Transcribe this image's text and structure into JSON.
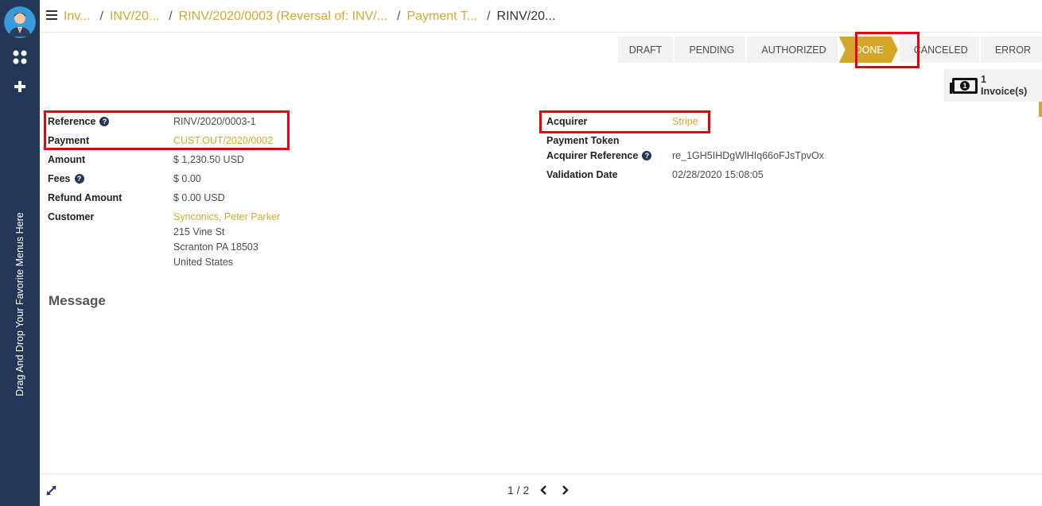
{
  "sidebar": {
    "favorites_hint": "Drag And Drop Your Favorite Menus Here"
  },
  "breadcrumb": {
    "items": [
      "Inv...",
      "INV/20...",
      "RINV/2020/0003 (Reversal of: INV/...",
      "Payment T..."
    ],
    "current": "RINV/20..."
  },
  "statusbar": {
    "stages": [
      "DRAFT",
      "PENDING",
      "AUTHORIZED",
      "DONE",
      "CANCELED",
      "ERROR"
    ],
    "active": "DONE"
  },
  "smart_button": {
    "count": "1",
    "label": "Invoice(s)"
  },
  "form": {
    "left": {
      "reference_label": "Reference",
      "reference_value": "RINV/2020/0003-1",
      "payment_label": "Payment",
      "payment_value": "CUST.OUT/2020/0002",
      "amount_label": "Amount",
      "amount_value": "$ 1,230.50  USD",
      "fees_label": "Fees",
      "fees_value": "$ 0.00",
      "refund_label": "Refund Amount",
      "refund_value": "$ 0.00  USD",
      "customer_label": "Customer",
      "customer_name": "Synconics, Peter Parker",
      "address_line1": "215 Vine St",
      "address_line2": "Scranton PA 18503",
      "address_line3": "United States"
    },
    "right": {
      "acquirer_label": "Acquirer",
      "acquirer_value": "Stripe",
      "token_label": "Payment Token",
      "acq_ref_label": "Acquirer Reference",
      "acq_ref_value": "re_1GH5IHDgWlHIq66oFJsTpvOx",
      "validation_label": "Validation Date",
      "validation_value": "02/28/2020 15:08:05"
    },
    "message_title": "Message"
  },
  "pager": {
    "value": "1 / 2"
  },
  "colors": {
    "sidebar": "#243757",
    "accent": "#d4a72c",
    "highlight": "#e8000b"
  }
}
